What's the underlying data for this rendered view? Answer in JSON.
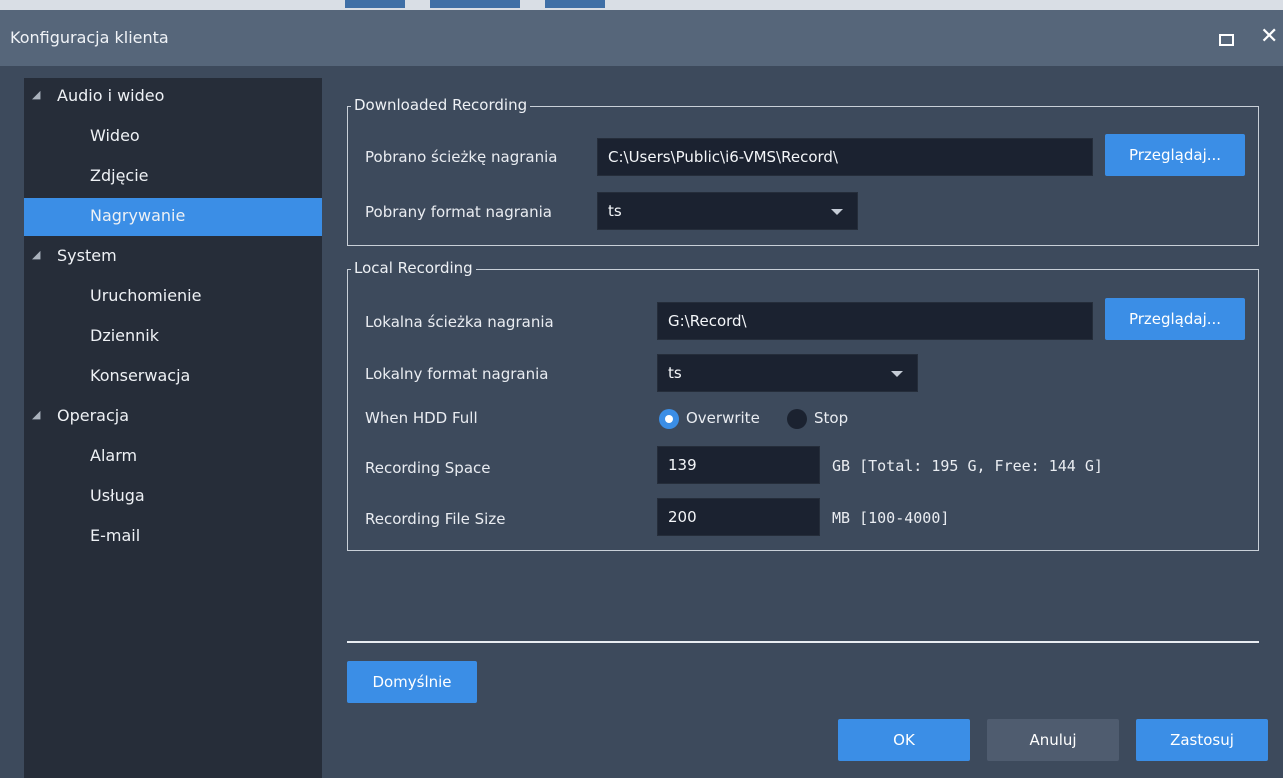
{
  "window": {
    "title": "Konfiguracja klienta"
  },
  "sidebar": {
    "items": [
      {
        "label": "Audio i wideo",
        "level": 0,
        "expanded": true
      },
      {
        "label": "Wideo",
        "level": 1
      },
      {
        "label": "Zdjęcie",
        "level": 1
      },
      {
        "label": "Nagrywanie",
        "level": 1,
        "selected": true
      },
      {
        "label": "System",
        "level": 0,
        "expanded": true
      },
      {
        "label": "Uruchomienie",
        "level": 1
      },
      {
        "label": "Dziennik",
        "level": 1
      },
      {
        "label": "Konserwacja",
        "level": 1
      },
      {
        "label": "Operacja",
        "level": 0,
        "expanded": true
      },
      {
        "label": "Alarm",
        "level": 1
      },
      {
        "label": "Usługa",
        "level": 1
      },
      {
        "label": "E-mail",
        "level": 1
      }
    ]
  },
  "downloaded": {
    "title": "Downloaded Recording",
    "path_label": "Pobrano ścieżkę nagrania",
    "path_value": "C:\\Users\\Public\\i6-VMS\\Record\\",
    "browse_label": "Przeglądaj...",
    "format_label": "Pobrany format nagrania",
    "format_value": "ts"
  },
  "local": {
    "title": "Local Recording",
    "path_label": "Lokalna ścieżka nagrania",
    "path_value": "G:\\Record\\",
    "browse_label": "Przeglądaj...",
    "format_label": "Lokalny format nagrania",
    "format_value": "ts",
    "hdd_full_label": "When HDD Full",
    "overwrite_label": "Overwrite",
    "stop_label": "Stop",
    "hdd_full_selected": "Overwrite",
    "space_label": "Recording Space",
    "space_value": "139",
    "space_hint": "GB [Total: 195 G, Free: 144 G]",
    "filesize_label": "Recording File Size",
    "filesize_value": "200",
    "filesize_hint": "MB [100-4000]"
  },
  "footer": {
    "default_label": "Domyślnie",
    "ok_label": "OK",
    "cancel_label": "Anuluj",
    "apply_label": "Zastosuj"
  },
  "colors": {
    "accent": "#3b8ee6",
    "window_bg": "#3d4a5c",
    "sidebar_bg": "#262d39",
    "input_bg": "#1b2230",
    "titlebar_bg": "#56667a"
  }
}
